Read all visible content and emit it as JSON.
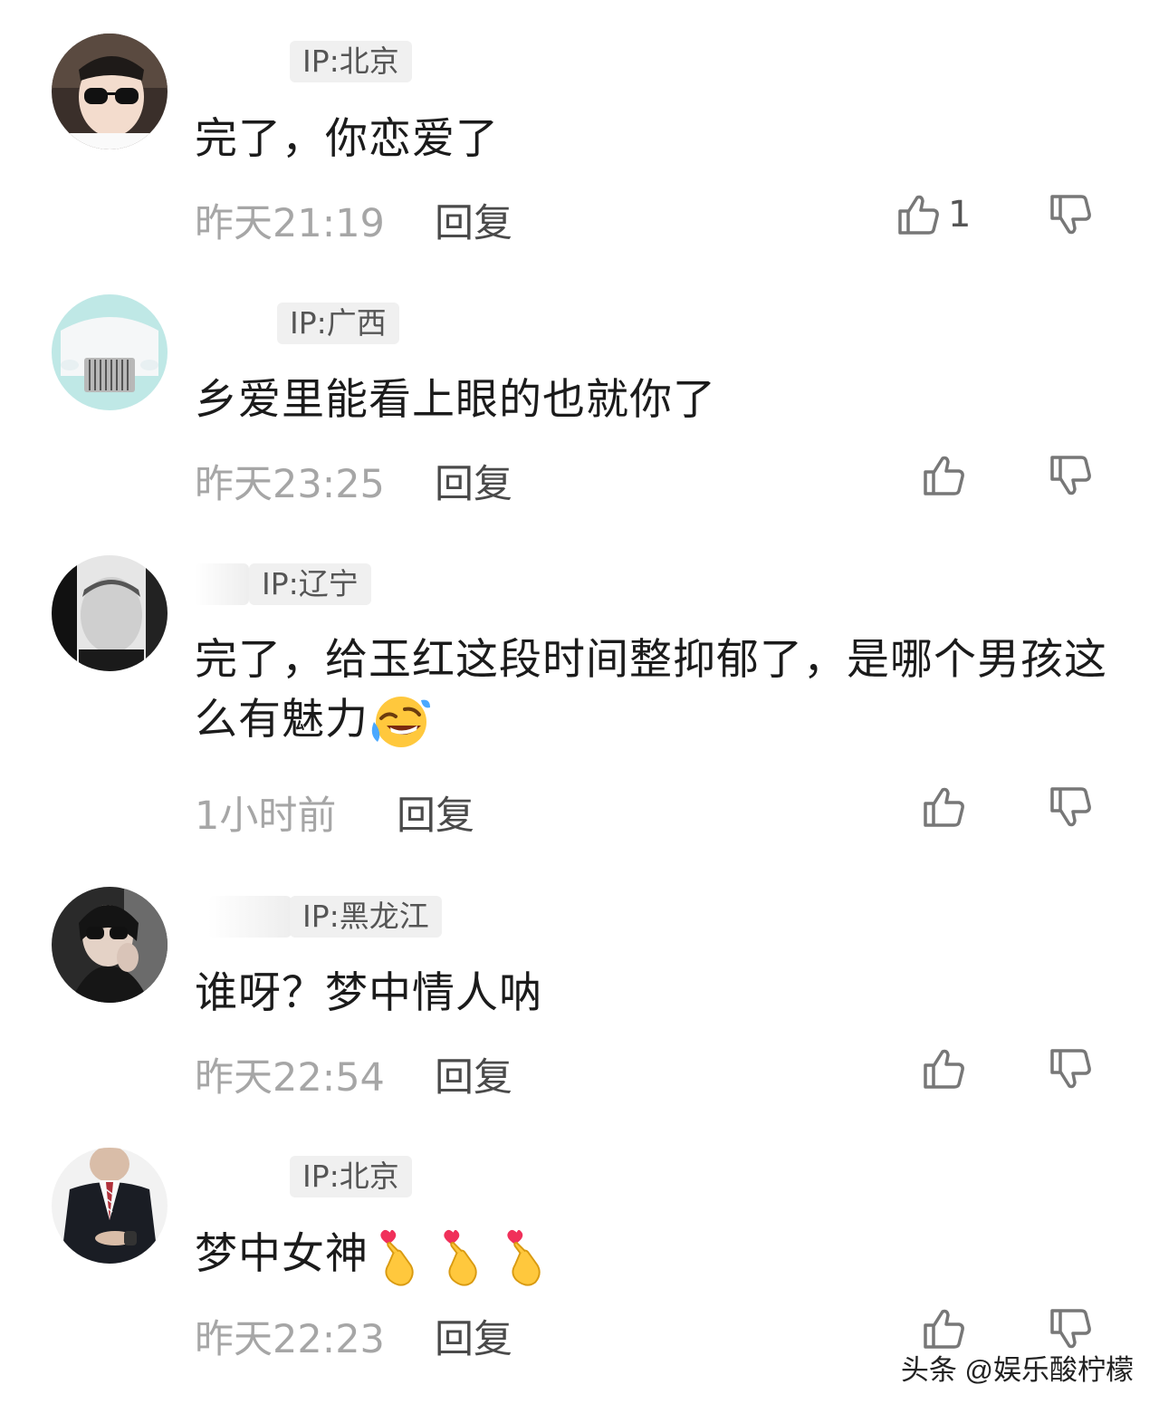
{
  "comments": [
    {
      "ip": "IP:北京",
      "text": "完了，你恋爱了",
      "time": "昨天21:19",
      "reply": "回复",
      "likes": "1",
      "avatar": "avatar-sunglasses-man"
    },
    {
      "ip": "IP:广西",
      "text": "乡爱里能看上眼的也就你了",
      "time": "昨天23:25",
      "reply": "回复",
      "likes": "",
      "avatar": "avatar-white-car"
    },
    {
      "ip": "IP:辽宁",
      "text": "完了，给玉红这段时间整抑郁了，是哪个男孩这么有魅力",
      "emoji": "rofl-emoji",
      "time": "1小时前",
      "reply": "回复",
      "likes": "",
      "avatar": "avatar-bw-portrait"
    },
    {
      "ip": "IP:黑龙江",
      "text": "谁呀？梦中情人呐",
      "time": "昨天22:54",
      "reply": "回复",
      "likes": "",
      "avatar": "avatar-dark-selfie"
    },
    {
      "ip": "IP:北京",
      "text": "梦中女神",
      "emoji": "finger-heart-emoji x3",
      "time": "昨天22:23",
      "reply": "回复",
      "likes": "",
      "avatar": "avatar-suit-man"
    }
  ],
  "watermark": "头条 @娱乐酸柠檬",
  "colors": {
    "ip_bg": "#f0f0f0",
    "meta": "#a6a6a6",
    "text": "#1b1b1b"
  }
}
